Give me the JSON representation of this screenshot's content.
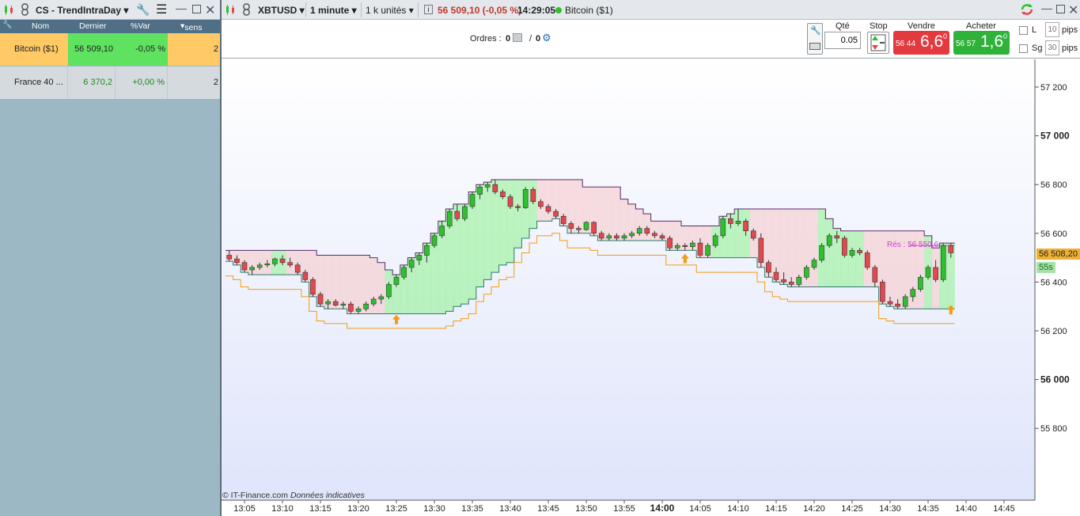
{
  "left_panel": {
    "title": "CS - TrendIntraDay",
    "columns": [
      "Nom",
      "Dernier",
      "%Var",
      "sens"
    ],
    "rows": [
      {
        "name": "Bitcoin ($1)",
        "last": "56 509,10",
        "var": "-0,05 %",
        "sens": "2"
      },
      {
        "name": "France 40 ...",
        "last": "6 370,2",
        "var": "+0,00 %",
        "sens": "2"
      }
    ]
  },
  "toolbar": {
    "symbol": "XBTUSD",
    "timeframe": "1 minute",
    "units": "1 k unités",
    "price": "56 509,10 (-0,05 %)",
    "time": "14:29:05",
    "instrument": "Bitcoin ($1)"
  },
  "orders": {
    "label": "Ordres :",
    "count1": "0",
    "count2": "0"
  },
  "trade": {
    "qty_label": "Qté",
    "qty_value": "0.05",
    "stop_label": "Stop",
    "sell_label": "Vendre",
    "sell_small": "56 44",
    "sell_big": "6,6",
    "sell_sup": "0",
    "buy_label": "Acheter",
    "buy_small": "56 57",
    "buy_big": "1,6",
    "buy_sup": "0",
    "l_label": "L",
    "l_value": "10",
    "sg_label": "Sg",
    "sg_value": "30",
    "pips_label": "pips"
  },
  "chart": {
    "resistance_label": "Rés : 56 550,6",
    "last_price_tag": "56 508,20",
    "countdown_tag": "55s",
    "footer": "© IT-Finance.com",
    "footer_italic": "Données indicatives",
    "colors": {
      "up": "#2ec02e",
      "down": "#e2484e",
      "band_green": "#8ef08e",
      "band_red": "#f5c6c6",
      "trail": "#f39c12",
      "resistance": "#e040e0"
    }
  },
  "chart_data": {
    "type": "candlestick",
    "y_ticks": [
      "57 200",
      "57 000",
      "56 800",
      "56 600",
      "56 400",
      "56 200",
      "56 000",
      "55 800"
    ],
    "x_ticks": [
      "13:05",
      "13:10",
      "13:15",
      "13:20",
      "13:25",
      "13:30",
      "13:35",
      "13:40",
      "13:45",
      "13:50",
      "13:55",
      "14:00",
      "14:05",
      "14:10",
      "14:15",
      "14:20",
      "14:25",
      "14:30",
      "14:35",
      "14:40",
      "14:45"
    ],
    "ylim": [
      55600,
      57350
    ],
    "candles": [
      [
        56510,
        56530,
        56485,
        56495
      ],
      [
        56495,
        56510,
        56470,
        56480
      ],
      [
        56480,
        56490,
        56440,
        56450
      ],
      [
        56450,
        56470,
        56430,
        56460
      ],
      [
        56460,
        56480,
        56450,
        56470
      ],
      [
        56470,
        56490,
        56460,
        56475
      ],
      [
        56475,
        56500,
        56465,
        56495
      ],
      [
        56495,
        56510,
        56470,
        56480
      ],
      [
        56480,
        56500,
        56460,
        56470
      ],
      [
        56470,
        56480,
        56430,
        56440
      ],
      [
        56440,
        56450,
        56400,
        56410
      ],
      [
        56410,
        56420,
        56340,
        56350
      ],
      [
        56350,
        56360,
        56300,
        56310
      ],
      [
        56310,
        56330,
        56290,
        56320
      ],
      [
        56320,
        56330,
        56300,
        56305
      ],
      [
        56305,
        56320,
        56290,
        56310
      ],
      [
        56310,
        56320,
        56270,
        56280
      ],
      [
        56280,
        56300,
        56270,
        56290
      ],
      [
        56290,
        56320,
        56280,
        56310
      ],
      [
        56310,
        56340,
        56300,
        56330
      ],
      [
        56330,
        56350,
        56310,
        56340
      ],
      [
        56340,
        56400,
        56330,
        56390
      ],
      [
        56390,
        56430,
        56380,
        56420
      ],
      [
        56420,
        56470,
        56410,
        56460
      ],
      [
        56460,
        56500,
        56440,
        56490
      ],
      [
        56490,
        56520,
        56470,
        56510
      ],
      [
        56510,
        56560,
        56480,
        56550
      ],
      [
        56550,
        56600,
        56540,
        56590
      ],
      [
        56590,
        56650,
        56580,
        56630
      ],
      [
        56630,
        56700,
        56620,
        56690
      ],
      [
        56690,
        56720,
        56650,
        56660
      ],
      [
        56660,
        56720,
        56650,
        56710
      ],
      [
        56710,
        56770,
        56700,
        56760
      ],
      [
        56760,
        56800,
        56740,
        56790
      ],
      [
        56790,
        56810,
        56770,
        56800
      ],
      [
        56800,
        56820,
        56760,
        56770
      ],
      [
        56770,
        56780,
        56740,
        56750
      ],
      [
        56750,
        56760,
        56700,
        56710
      ],
      [
        56710,
        56720,
        56690,
        56705
      ],
      [
        56705,
        56790,
        56700,
        56780
      ],
      [
        56780,
        56790,
        56720,
        56730
      ],
      [
        56730,
        56740,
        56700,
        56710
      ],
      [
        56710,
        56720,
        56680,
        56690
      ],
      [
        56690,
        56700,
        56660,
        56670
      ],
      [
        56670,
        56680,
        56630,
        56640
      ],
      [
        56640,
        56650,
        56600,
        56620
      ],
      [
        56620,
        56630,
        56600,
        56615
      ],
      [
        56615,
        56650,
        56610,
        56645
      ],
      [
        56645,
        56650,
        56590,
        56600
      ],
      [
        56600,
        56610,
        56570,
        56580
      ],
      [
        56580,
        56600,
        56570,
        56590
      ],
      [
        56590,
        56600,
        56570,
        56580
      ],
      [
        56580,
        56600,
        56570,
        56590
      ],
      [
        56590,
        56610,
        56580,
        56600
      ],
      [
        56600,
        56630,
        56590,
        56620
      ],
      [
        56620,
        56630,
        56590,
        56600
      ],
      [
        56600,
        56610,
        56580,
        56590
      ],
      [
        56590,
        56600,
        56570,
        56580
      ],
      [
        56580,
        56590,
        56530,
        56540
      ],
      [
        56540,
        56560,
        56530,
        56550
      ],
      [
        56550,
        56560,
        56530,
        56545
      ],
      [
        56545,
        56570,
        56530,
        56560
      ],
      [
        56560,
        56580,
        56500,
        56510
      ],
      [
        56510,
        56560,
        56500,
        56550
      ],
      [
        56550,
        56600,
        56540,
        56590
      ],
      [
        56590,
        56670,
        56580,
        56660
      ],
      [
        56660,
        56680,
        56620,
        56640
      ],
      [
        56640,
        56700,
        56630,
        56650
      ],
      [
        56650,
        56660,
        56590,
        56610
      ],
      [
        56610,
        56620,
        56570,
        56580
      ],
      [
        56580,
        56600,
        56460,
        56480
      ],
      [
        56480,
        56490,
        56420,
        56440
      ],
      [
        56440,
        56460,
        56400,
        56410
      ],
      [
        56410,
        56440,
        56390,
        56400
      ],
      [
        56400,
        56420,
        56380,
        56390
      ],
      [
        56390,
        56430,
        56380,
        56420
      ],
      [
        56420,
        56470,
        56410,
        56460
      ],
      [
        56460,
        56500,
        56450,
        56490
      ],
      [
        56490,
        56560,
        56480,
        56550
      ],
      [
        56550,
        56600,
        56540,
        56590
      ],
      [
        56590,
        56610,
        56560,
        56580
      ],
      [
        56580,
        56590,
        56500,
        56510
      ],
      [
        56510,
        56540,
        56500,
        56530
      ],
      [
        56530,
        56540,
        56510,
        56520
      ],
      [
        56520,
        56530,
        56450,
        56460
      ],
      [
        56460,
        56470,
        56380,
        56400
      ],
      [
        56400,
        56410,
        56310,
        56320
      ],
      [
        56320,
        56340,
        56300,
        56310
      ],
      [
        56310,
        56330,
        56290,
        56300
      ],
      [
        56300,
        56350,
        56290,
        56340
      ],
      [
        56340,
        56380,
        56320,
        56370
      ],
      [
        56370,
        56430,
        56360,
        56420
      ],
      [
        56420,
        56470,
        56410,
        56460
      ],
      [
        56460,
        56490,
        56400,
        56410
      ],
      [
        56410,
        56560,
        56400,
        56550
      ],
      [
        56550,
        56560,
        56500,
        56520
      ]
    ]
  }
}
